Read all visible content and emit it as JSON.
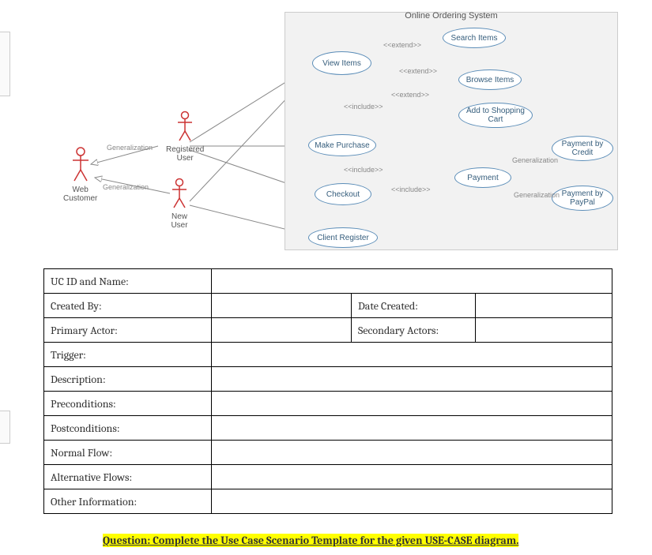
{
  "system_title": "Online Ordering System",
  "actors": {
    "web_customer": "Web\nCustomer",
    "registered_user": "Registered\nUser",
    "new_user": "New\nUser"
  },
  "usecases": {
    "view_items": "View Items",
    "make_purchase": "Make Purchase",
    "checkout": "Checkout",
    "client_register": "Client Register",
    "search_items": "Search Items",
    "browse_items": "Browse Items",
    "add_to_cart": "Add to Shopping\nCart",
    "payment": "Payment",
    "pay_credit": "Payment by\nCredit",
    "pay_paypal": "Payment by\nPayPal"
  },
  "stereotypes": {
    "extend": "<<extend>>",
    "include": "<<include>>",
    "generalization": "Generalization"
  },
  "table_rows": {
    "uc_id": "UC ID and Name:",
    "created_by": "Created By:",
    "date_created": "Date Created:",
    "primary_actor": "Primary Actor:",
    "secondary_actors": "Secondary Actors:",
    "trigger": "Trigger:",
    "description": "Description:",
    "preconditions": "Preconditions:",
    "postconditions": "Postconditions:",
    "normal_flow": "Normal Flow:",
    "alt_flows": "Alternative Flows:",
    "other_info": "Other Information:"
  },
  "question": "Question: Complete the Use Case Scenario Template for the given USE-CASE diagram."
}
